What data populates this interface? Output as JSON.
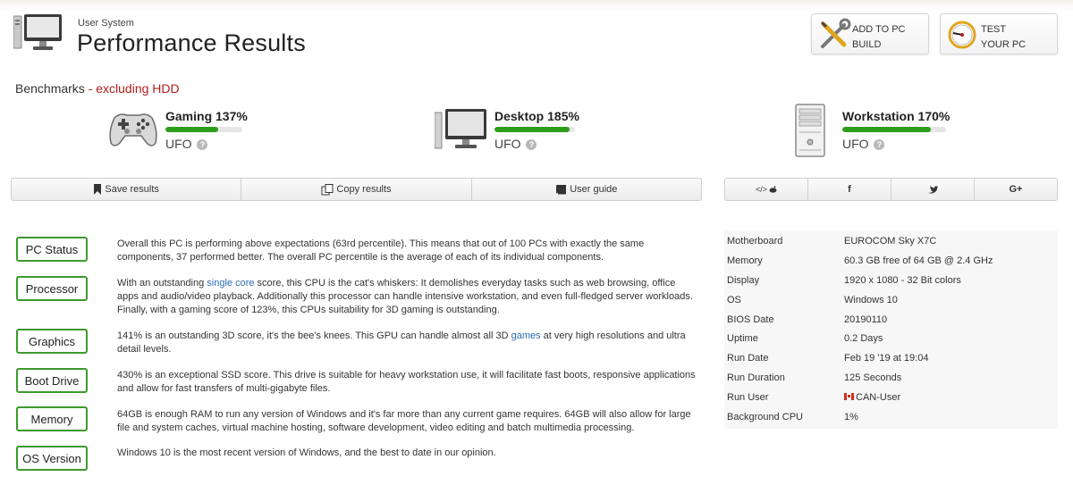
{
  "header": {
    "subtitle": "User System",
    "title": "Performance Results",
    "add_button": {
      "line1": "ADD TO PC",
      "line2": "BUILD",
      "icon": "wrench-screwdriver-icon"
    },
    "test_button": {
      "line1": "TEST",
      "line2": "YOUR PC",
      "icon": "gauge-icon"
    }
  },
  "benchmarks": {
    "label": "Benchmarks",
    "qualifier": " - excluding HDD",
    "items": [
      {
        "name": "Gaming 137%",
        "rating": "UFO",
        "progress": 0.69,
        "icon": "gamepad-icon"
      },
      {
        "name": "Desktop 185%",
        "rating": "UFO",
        "progress": 0.93,
        "icon": "monitor-icon"
      },
      {
        "name": "Workstation 170%",
        "rating": "UFO",
        "progress": 0.85,
        "icon": "tower-icon"
      }
    ],
    "bar_color": "#2d9e1c"
  },
  "actions": {
    "save": "Save results",
    "copy": "Copy results",
    "guide": "User guide"
  },
  "share": {
    "embed": "</>",
    "facebook": "f",
    "twitter": "t",
    "google": "G+"
  },
  "status": {
    "pc_status": {
      "label": "PC Status",
      "text": "Overall this PC is performing above expectations (63rd percentile). This means that out of 100 PCs with exactly the same components, 37 performed better. The overall PC percentile is the average of each of its individual components."
    },
    "processor": {
      "label": "Processor",
      "pre": "With an outstanding ",
      "link": "single core",
      "post": " score, this CPU is the cat's whiskers: It demolishes everyday tasks such as web browsing, office apps and audio/video playback. Additionally this processor can handle intensive workstation, and even full-fledged server workloads. Finally, with a gaming score of 123%, this CPUs suitability for 3D gaming is outstanding."
    },
    "graphics": {
      "label": "Graphics",
      "pre": "141% is an outstanding 3D score, it's the bee's knees. This GPU can handle almost all 3D ",
      "link": "games",
      "post": " at very high resolutions and ultra detail levels."
    },
    "boot_drive": {
      "label": "Boot Drive",
      "text": "430% is an exceptional SSD score. This drive is suitable for heavy workstation use, it will facilitate fast boots, responsive applications and allow for fast transfers of multi-gigabyte files."
    },
    "memory": {
      "label": "Memory",
      "text": "64GB is enough RAM to run any version of Windows and it's far more than any current game requires. 64GB will also allow for large file and system caches, virtual machine hosting, software development, video editing and batch multimedia processing."
    },
    "os_version": {
      "label": "OS Version",
      "text": "Windows 10 is the most recent version of Windows, and the best to date in our opinion."
    }
  },
  "specs": [
    {
      "key": "Motherboard",
      "value": "EUROCOM Sky X7C"
    },
    {
      "key": "Memory",
      "value": "60.3 GB free of 64 GB @ 2.4 GHz"
    },
    {
      "key": "Display",
      "value": "1920 x 1080 - 32 Bit colors"
    },
    {
      "key": "OS",
      "value": "Windows 10"
    },
    {
      "key": "BIOS Date",
      "value": "20190110"
    },
    {
      "key": "Uptime",
      "value": "0.2 Days"
    },
    {
      "key": "Run Date",
      "value": "Feb 19 '19 at 19:04"
    },
    {
      "key": "Run Duration",
      "value": "125 Seconds"
    },
    {
      "key": "Run User",
      "value": "CAN-User",
      "flag": "canada-flag-icon"
    },
    {
      "key": "Background CPU",
      "value": "1%"
    }
  ]
}
